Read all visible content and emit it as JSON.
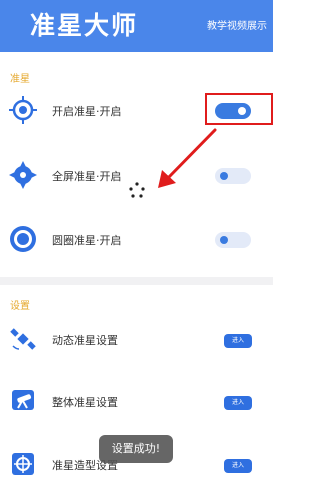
{
  "header": {
    "title": "准星大师",
    "tutorial_label": "教学视频展示"
  },
  "sections": {
    "crosshair_label": "准星",
    "settings_label": "设置"
  },
  "crosshair_rows": [
    {
      "label": "开启准星·开启",
      "icon": "crosshair-target-icon",
      "toggle_on": true
    },
    {
      "label": "全屏准星·开启",
      "icon": "crosshair-diamond-icon",
      "toggle_on": false
    },
    {
      "label": "圆圈准星·开启",
      "icon": "circle-crosshair-icon",
      "toggle_on": false
    }
  ],
  "setting_rows": [
    {
      "label": "动态准星设置",
      "icon": "satellite-icon",
      "button_label": "进入"
    },
    {
      "label": "整体准星设置",
      "icon": "telescope-icon",
      "button_label": "进入"
    },
    {
      "label": "准星造型设置",
      "icon": "shape-settings-icon",
      "button_label": "进入"
    }
  ],
  "toast": {
    "text": "设置成功!"
  },
  "colors": {
    "header": "#4a86ea",
    "accent": "#3a7be0",
    "section_label": "#e5a82e",
    "highlight": "#e01c1c"
  }
}
